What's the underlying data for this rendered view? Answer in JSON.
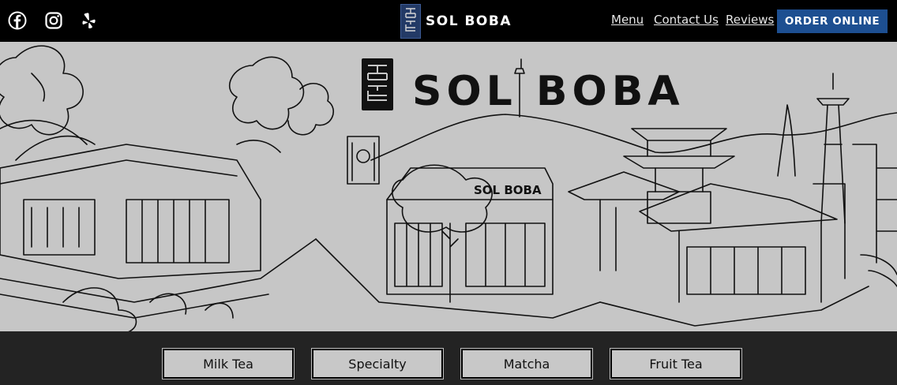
{
  "header": {
    "social": [
      {
        "icon": "facebook-icon"
      },
      {
        "icon": "instagram-icon"
      },
      {
        "icon": "yelp-icon"
      }
    ],
    "brand": "SOL BOBA",
    "nav": [
      {
        "label": "Menu"
      },
      {
        "label": "Contact Us"
      },
      {
        "label": "Reviews"
      }
    ],
    "order_button": "ORDER ONLINE",
    "accent": "#1d4f91"
  },
  "hero": {
    "title": "SOL BOBA",
    "shop_sign": "SOL BOBA"
  },
  "categories": [
    {
      "label": "Milk Tea"
    },
    {
      "label": "Specialty"
    },
    {
      "label": "Matcha"
    },
    {
      "label": "Fruit Tea"
    }
  ]
}
